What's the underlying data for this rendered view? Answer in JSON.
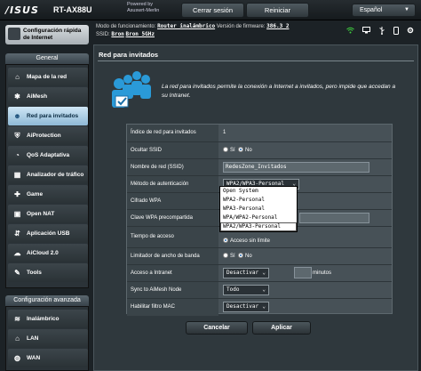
{
  "app": {
    "brand": "/ISUS",
    "model": "RT-AX88U",
    "powered_line1": "Powered by",
    "powered_line2": "Asuswrt-Merlin"
  },
  "top_buttons": {
    "logout": "Cerrar sesión",
    "reboot": "Reiniciar"
  },
  "language": {
    "selected": "Español"
  },
  "info": {
    "mode_label": "Modo de funcionamiento:",
    "mode_value": "Router inalámbrico",
    "firmware_label": "Versión de firmware:",
    "firmware_value": "386.3_2",
    "ssid_label": "SSID:",
    "ssid_1": "Bron",
    "ssid_2": "Bron_5GHz"
  },
  "sidebar": {
    "qis_label": "Configuración rápida de Internet",
    "general_header": "General",
    "general_items": [
      {
        "label": "Mapa de la red",
        "icon": "network-map-icon"
      },
      {
        "label": "AiMesh",
        "icon": "aimesh-icon"
      },
      {
        "label": "Red para invitados",
        "icon": "guest-network-icon",
        "active": true
      },
      {
        "label": "AiProtection",
        "icon": "aiprotection-icon"
      },
      {
        "label": "QoS Adaptativa",
        "icon": "qos-icon"
      },
      {
        "label": "Analizador de tráfico",
        "icon": "traffic-analyzer-icon"
      },
      {
        "label": "Game",
        "icon": "game-icon"
      },
      {
        "label": "Open NAT",
        "icon": "open-nat-icon"
      },
      {
        "label": "Aplicación USB",
        "icon": "usb-icon"
      },
      {
        "label": "AiCloud 2.0",
        "icon": "aicloud-icon"
      },
      {
        "label": "Tools",
        "icon": "tools-icon"
      }
    ],
    "advanced_header": "Configuración avanzada",
    "advanced_items": [
      {
        "label": "Inalámbrico",
        "icon": "wireless-icon"
      },
      {
        "label": "LAN",
        "icon": "lan-icon"
      },
      {
        "label": "WAN",
        "icon": "wan-icon"
      }
    ]
  },
  "page": {
    "title": "Red para invitados",
    "description": "La red para invitados permite la conexión a Internet a invitados, pero impide que accedan a su Intranet."
  },
  "form": {
    "rows": {
      "index": {
        "label": "Índice de red para invitados",
        "value": "1"
      },
      "hide_ssid": {
        "label": "Ocultar SSID",
        "yes": "Sí",
        "no": "No"
      },
      "ssid": {
        "label": "Nombre de red (SSID)",
        "value": "RedesZone_Invitados"
      },
      "auth": {
        "label": "Método de autenticación",
        "value": "WPA2/WPA3-Personal"
      },
      "wpa_enc": {
        "label": "Cifrado WPA"
      },
      "wpa_key": {
        "label": "Clave WPA precompartida"
      },
      "access_time": {
        "label": "Tiempo de acceso",
        "unit": "minutos",
        "unlimited": "Acceso sin límite"
      },
      "bandwidth": {
        "label": "Limitador de ancho de banda",
        "yes": "Sí",
        "no": "No"
      },
      "intranet": {
        "label": "Acceso a Intranet",
        "value": "Desactivar"
      },
      "aimesh_sync": {
        "label": "Sync to AiMesh Node",
        "value": "Todo"
      },
      "mac_filter": {
        "label": "Habilitar filtro MAC",
        "value": "Desactivar"
      }
    },
    "auth_options": [
      "Open System",
      "WPA2-Personal",
      "WPA3-Personal",
      "WPA/WPA2-Personal",
      "WPA2/WPA3-Personal"
    ]
  },
  "buttons": {
    "cancel": "Cancelar",
    "apply": "Aplicar"
  },
  "colors": {
    "accent": "#2b6fb5",
    "active_item": "#8fb9d6",
    "background": "#1c2226"
  }
}
